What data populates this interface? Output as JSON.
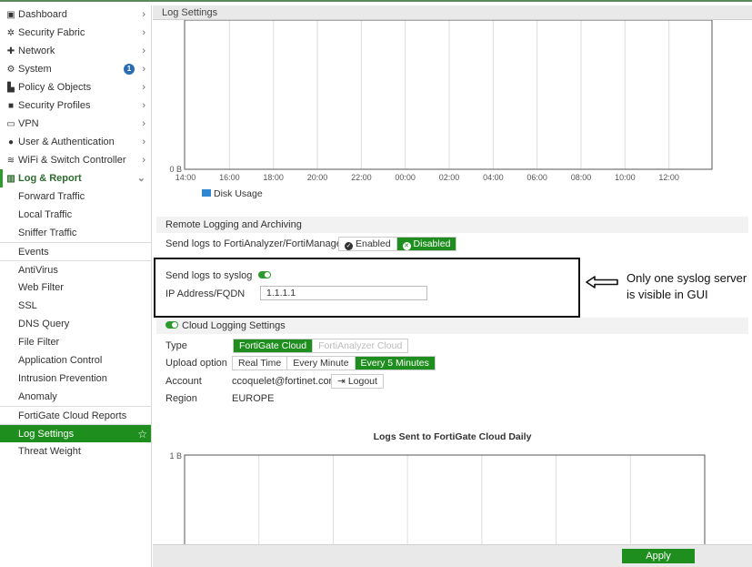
{
  "sidebar": {
    "items": [
      {
        "label": "Dashboard",
        "icon": "dashboard-icon",
        "glyph": "▣"
      },
      {
        "label": "Security Fabric",
        "icon": "security-fabric-icon",
        "glyph": "✲"
      },
      {
        "label": "Network",
        "icon": "network-icon",
        "glyph": "✚"
      },
      {
        "label": "System",
        "icon": "gear-icon",
        "glyph": "⚙",
        "badge": "1"
      },
      {
        "label": "Policy & Objects",
        "icon": "policy-icon",
        "glyph": "▙"
      },
      {
        "label": "Security Profiles",
        "icon": "lock-icon",
        "glyph": "🔒"
      },
      {
        "label": "VPN",
        "icon": "laptop-icon",
        "glyph": "▭"
      },
      {
        "label": "User & Authentication",
        "icon": "user-icon",
        "glyph": "●"
      },
      {
        "label": "WiFi & Switch Controller",
        "icon": "wifi-icon",
        "glyph": "≋"
      },
      {
        "label": "Log & Report",
        "icon": "chart-icon",
        "glyph": "▥"
      }
    ],
    "log_report_children": [
      "Forward Traffic",
      "Local Traffic",
      "Sniffer Traffic",
      "Events",
      "AntiVirus",
      "Web Filter",
      "SSL",
      "DNS Query",
      "File Filter",
      "Application Control",
      "Intrusion Prevention",
      "Anomaly",
      "FortiGate Cloud Reports",
      "Log Settings",
      "Threat Weight"
    ]
  },
  "header": {
    "title": "Log Settings"
  },
  "disk_chart": {
    "y_zero_label": "0 B",
    "x_ticks": [
      "14:00",
      "16:00",
      "18:00",
      "20:00",
      "22:00",
      "00:00",
      "02:00",
      "04:00",
      "06:00",
      "08:00",
      "10:00",
      "12:00"
    ],
    "legend": "Disk Usage",
    "legend_color": "#2f86d1"
  },
  "remote_logging": {
    "section_title": "Remote Logging and Archiving",
    "fortianalyzer_label": "Send logs to FortiAnalyzer/FortiManager",
    "enabled_label": "Enabled",
    "disabled_label": "Disabled",
    "syslog_label": "Send logs to syslog",
    "ip_label": "IP Address/FQDN",
    "ip_value": "1.1.1.1"
  },
  "annotation": {
    "line1": "Only one syslog server",
    "line2": "is visible in GUI"
  },
  "cloud": {
    "section_title": "Cloud Logging Settings",
    "type_label": "Type",
    "type_options": [
      "FortiGate Cloud",
      "FortiAnalyzer Cloud"
    ],
    "upload_label": "Upload option",
    "upload_options": [
      "Real Time",
      "Every Minute",
      "Every 5 Minutes"
    ],
    "account_label": "Account",
    "account_value": "ccoquelet@fortinet.com",
    "logout_label": "Logout",
    "region_label": "Region",
    "region_value": "EUROPE"
  },
  "cloud_chart": {
    "title": "Logs Sent to FortiGate Cloud Daily",
    "y_label": "1 B"
  },
  "footer": {
    "apply_label": "Apply"
  },
  "colors": {
    "accent": "#1e8e1e",
    "badge": "#2a6cb3"
  }
}
